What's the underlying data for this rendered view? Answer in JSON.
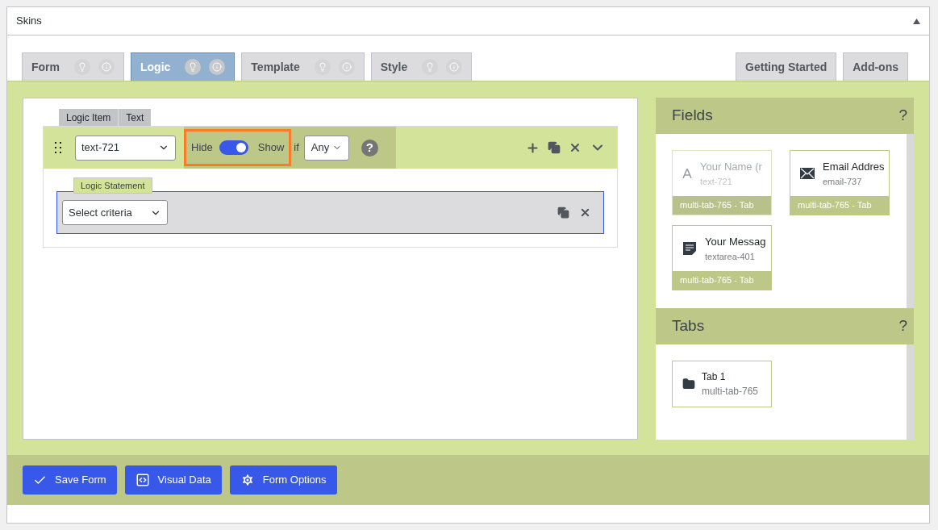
{
  "panel": {
    "title": "Skins"
  },
  "tabs": [
    {
      "label": "Form",
      "selected": false
    },
    {
      "label": "Logic",
      "selected": true
    },
    {
      "label": "Template",
      "selected": false
    },
    {
      "label": "Style",
      "selected": false
    }
  ],
  "right_tabs": [
    "Getting Started",
    "Add-ons"
  ],
  "logic_item": {
    "tab_labels": [
      "Logic Item",
      "Text"
    ],
    "field_select": "text-721",
    "hide_label": "Hide",
    "show_label": "Show",
    "show": true,
    "if_label": "if",
    "match_select": "Any",
    "help": "?",
    "statement": {
      "legend": "Logic Statement",
      "criteria_select": "Select criteria"
    }
  },
  "fields_panel": {
    "title": "Fields",
    "help": "?",
    "items": [
      {
        "kind": "text",
        "name": "Your Name (r",
        "id": "text-721",
        "tab": "multi-tab-765 - Tab",
        "disabled": true
      },
      {
        "kind": "email",
        "name": "Email Addres",
        "id": "email-737",
        "tab": "multi-tab-765 - Tab",
        "disabled": false
      },
      {
        "kind": "textarea",
        "name": "Your Messag",
        "id": "textarea-401",
        "tab": "multi-tab-765 - Tab",
        "disabled": false
      }
    ]
  },
  "tabs_panel": {
    "title": "Tabs",
    "help": "?",
    "items": [
      {
        "name": "Tab 1",
        "id": "multi-tab-765"
      }
    ]
  },
  "buttons": [
    {
      "kind": "save",
      "label": "Save Form"
    },
    {
      "kind": "data",
      "label": "Visual Data"
    },
    {
      "kind": "options",
      "label": "Form Options"
    }
  ]
}
